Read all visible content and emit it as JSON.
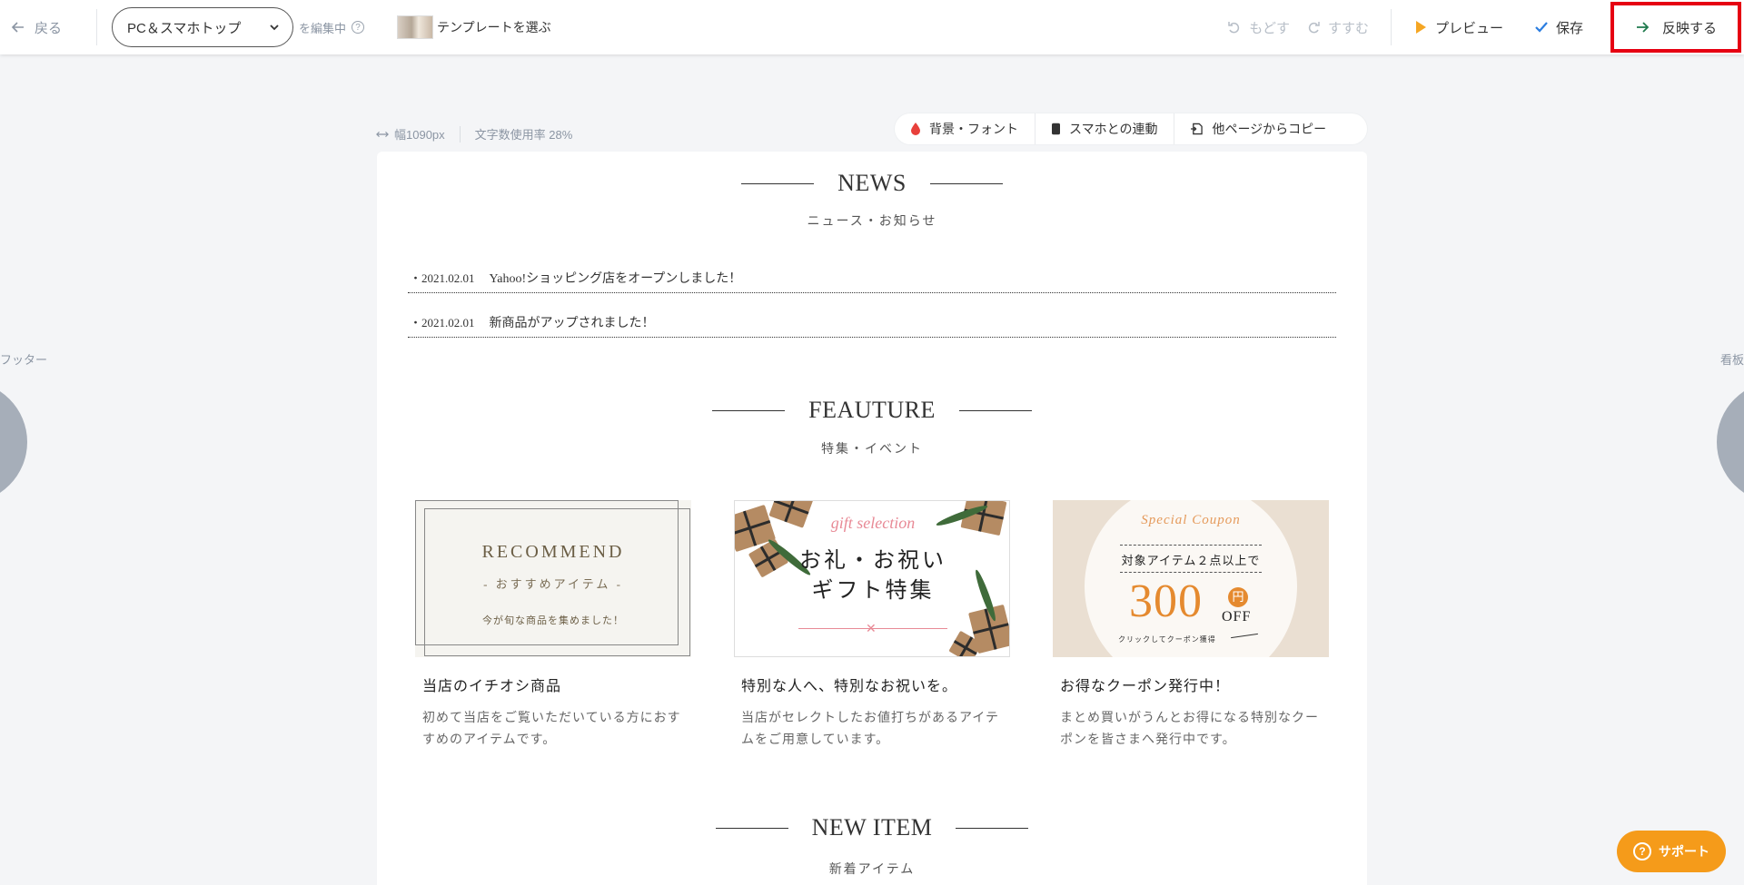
{
  "topbar": {
    "back_label": "戻る",
    "page_select_value": "PC＆スマホトップ",
    "editing_label": "を編集中",
    "help_glyph": "?",
    "template_label": "テンプレートを選ぶ",
    "undo_label": "もどす",
    "redo_label": "すすむ",
    "preview_label": "プレビュー",
    "save_label": "保存",
    "reflect_label": "反映する"
  },
  "info": {
    "width_label": "幅1090px",
    "usage_label": "文字数使用率 28%"
  },
  "toolbar2": {
    "bg_font_label": "背景・フォント",
    "phone_link_label": "スマホとの連動",
    "copy_label": "他ページからコピー"
  },
  "side": {
    "left_label": "フッター",
    "right_label": "看板"
  },
  "canvas": {
    "news": {
      "title": "NEWS",
      "subtitle": "ニュース・お知らせ",
      "items": [
        {
          "date": "・2021.02.01",
          "text": "Yahoo!ショッピング店をオープンしました！"
        },
        {
          "date": "・2021.02.01",
          "text": "新商品がアップされました！"
        }
      ]
    },
    "feature": {
      "title": "FEAUTURE",
      "subtitle": "特集・イベント",
      "cards": [
        {
          "banner": {
            "main": "RECOMMEND",
            "sub": "- おすすめアイテム -",
            "note": "今が旬な商品を集めました！"
          },
          "title": "当店のイチオシ商品",
          "desc": "初めて当店をご覧いただいている方におすすめのアイテムです。"
        },
        {
          "banner": {
            "script": "gift selection",
            "line1": "お礼・お祝い",
            "line2": "ギフト特集",
            "bow": "✕"
          },
          "title": "特別な人へ、特別なお祝いを。",
          "desc": "当店がセレクトしたお値打ちがあるアイテムをご用意しています。"
        },
        {
          "banner": {
            "special": "Special Coupon",
            "target": "対象アイテム２点以上で",
            "price": "300",
            "yen": "円",
            "off": "OFF",
            "click": "クリックしてクーポン獲得"
          },
          "title": "お得なクーポン発行中！",
          "desc": "まとめ買いがうんとお得になる特別なクーポンを皆さまへ発行中です。"
        }
      ]
    },
    "newitem": {
      "title": "NEW ITEM",
      "subtitle": "新着アイテム"
    }
  },
  "support": {
    "label": "サポート",
    "glyph": "?"
  },
  "colors": {
    "accent_red": "#e60012",
    "support_orange": "#f59b1a",
    "preview_orange": "#f5a623",
    "save_blue": "#2b7de0",
    "reflect_green": "#1f7a4d"
  }
}
